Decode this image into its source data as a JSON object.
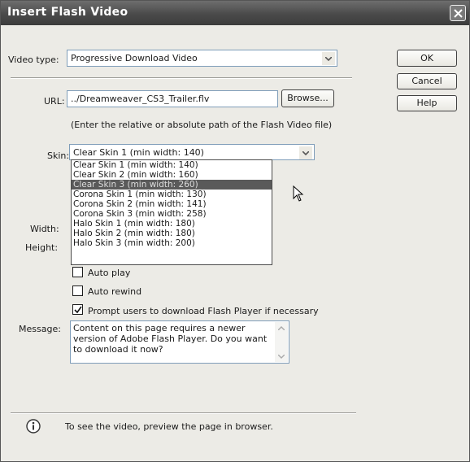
{
  "dialog": {
    "title": "Insert Flash Video"
  },
  "video_type": {
    "label": "Video type:",
    "value": "Progressive Download Video"
  },
  "buttons": {
    "ok": "OK",
    "cancel": "Cancel",
    "help": "Help",
    "browse": "Browse..."
  },
  "url": {
    "label": "URL:",
    "value": "../Dreamweaver_CS3_Trailer.flv",
    "hint": "(Enter the relative or absolute path of the Flash Video file)"
  },
  "skin": {
    "label": "Skin:",
    "value": "Clear Skin 1 (min width: 140)",
    "options": [
      "Clear Skin 1 (min width: 140)",
      "Clear Skin 2 (min width: 160)",
      "Clear Skin 3 (min width: 260)",
      "Corona Skin 1 (min width: 130)",
      "Corona Skin 2 (min width: 141)",
      "Corona Skin 3 (min width: 258)",
      "Halo Skin 1 (min width: 180)",
      "Halo Skin 2 (min width: 180)",
      "Halo Skin 3 (min width: 200)"
    ],
    "highlighted": "Clear Skin 3 (min width: 260)"
  },
  "dimensions": {
    "width_label": "Width:",
    "height_label": "Height:"
  },
  "options": {
    "auto_play": {
      "label": "Auto play",
      "checked": false
    },
    "auto_rewind": {
      "label": "Auto rewind",
      "checked": false
    },
    "prompt_download": {
      "label": "Prompt users to download Flash Player if necessary",
      "checked": true
    }
  },
  "message": {
    "label": "Message:",
    "value": "Content on this page requires a newer version of Adobe Flash Player. Do you want to download it now?"
  },
  "footer": {
    "info": "To see the video, preview the page in browser."
  },
  "icons": {
    "close": "close-icon",
    "dropdown": "chevron-down-icon",
    "info": "info-icon",
    "cursor": "mouse-cursor-icon",
    "check": "checkmark-icon"
  }
}
